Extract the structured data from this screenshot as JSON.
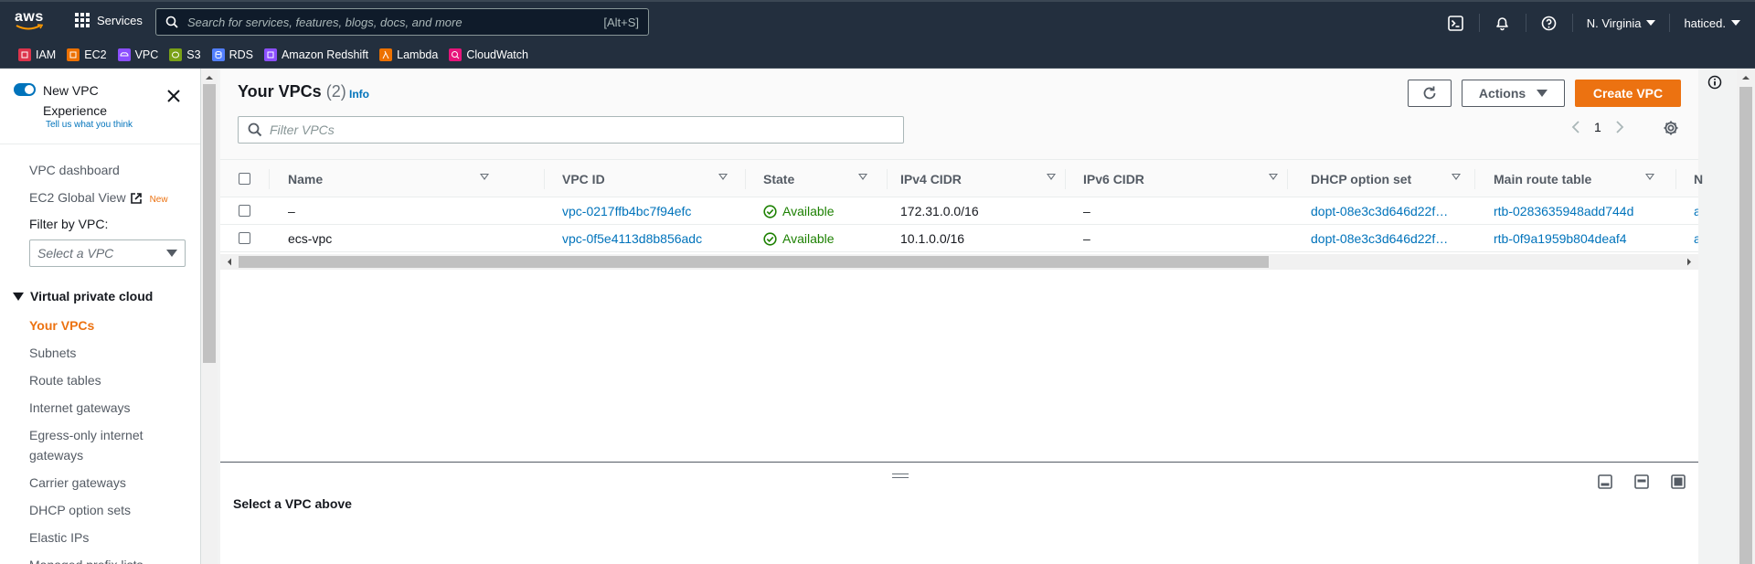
{
  "topnav": {
    "logo_text": "aws",
    "services_label": "Services",
    "search_placeholder": "Search for services, features, blogs, docs, and more",
    "search_shortcut": "[Alt+S]",
    "region_label": "N. Virginia",
    "account_label": "haticed."
  },
  "favorites": [
    {
      "label": "IAM",
      "color": "#dd344c"
    },
    {
      "label": "EC2",
      "color": "#ed7100"
    },
    {
      "label": "VPC",
      "color": "#8c4fff"
    },
    {
      "label": "S3",
      "color": "#7aa116"
    },
    {
      "label": "RDS",
      "color": "#527fff"
    },
    {
      "label": "Amazon Redshift",
      "color": "#8c4fff"
    },
    {
      "label": "Lambda",
      "color": "#ed7100"
    },
    {
      "label": "CloudWatch",
      "color": "#e7157b"
    }
  ],
  "sidebar": {
    "toggle_label": "New VPC Experience",
    "feedback_link": "Tell us what you think",
    "dashboard": "VPC dashboard",
    "global_view": "EC2 Global View",
    "new_badge": "New",
    "filter_label": "Filter by VPC:",
    "filter_placeholder": "Select a VPC",
    "section_title": "Virtual private cloud",
    "items": [
      {
        "label": "Your VPCs",
        "active": true
      },
      {
        "label": "Subnets"
      },
      {
        "label": "Route tables"
      },
      {
        "label": "Internet gateways"
      },
      {
        "label": "Egress-only internet gateways"
      },
      {
        "label": "Carrier gateways"
      },
      {
        "label": "DHCP option sets"
      },
      {
        "label": "Elastic IPs"
      },
      {
        "label": "Managed prefix lists"
      }
    ]
  },
  "main": {
    "title": "Your VPCs",
    "count": "(2)",
    "info_link": "Info",
    "actions_label": "Actions",
    "create_label": "Create VPC",
    "filter_placeholder": "Filter VPCs",
    "page_number": "1"
  },
  "table": {
    "columns": [
      "Name",
      "VPC ID",
      "State",
      "IPv4 CIDR",
      "IPv6 CIDR",
      "DHCP option set",
      "Main route table",
      "N"
    ],
    "rows": [
      {
        "name": "–",
        "vpc_id": "vpc-0217ffb4bc7f94efc",
        "state": "Available",
        "ipv4": "172.31.0.0/16",
        "ipv6": "–",
        "dhcp": "dopt-08e3c3d646d22f…",
        "route_table": "rtb-0283635948add744d",
        "next": "a"
      },
      {
        "name": "ecs-vpc",
        "vpc_id": "vpc-0f5e4113d8b856adc",
        "state": "Available",
        "ipv4": "10.1.0.0/16",
        "ipv6": "–",
        "dhcp": "dopt-08e3c3d646d22f…",
        "route_table": "rtb-0f9a1959b804deaf4",
        "next": "a"
      }
    ]
  },
  "split_panel": {
    "title": "Select a VPC above"
  },
  "colors": {
    "nav_bg": "#232f3e",
    "accent": "#ec7211",
    "link": "#0073bb",
    "success": "#1d8102"
  }
}
